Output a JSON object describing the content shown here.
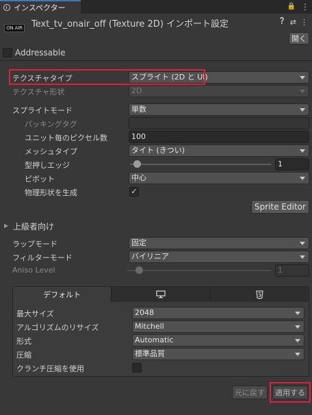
{
  "tab": {
    "label": "インスペクター"
  },
  "tab_icons": {
    "lock": "🔒",
    "menu": "⋮"
  },
  "header": {
    "badge": "ON AIR",
    "title": "Text_tv_onair_off (Texture 2D) インポート設定",
    "help": "❔",
    "settings": "⇄",
    "menu": "⋮",
    "open_label": "開く"
  },
  "addressable": {
    "label": "Addressable",
    "checked": false
  },
  "texture_type": {
    "label": "テクスチャタイプ",
    "value": "スプライト (2D と UI)"
  },
  "texture_shape": {
    "label": "テクスチャ形状",
    "value": "2D"
  },
  "sprite_mode": {
    "label": "スプライトモード",
    "value": "単数"
  },
  "packing_tag": {
    "label": "パッキングタグ",
    "value": ""
  },
  "pixels_per_unit": {
    "label": "ユニット毎のピクセル数",
    "value": "100"
  },
  "mesh_type": {
    "label": "メッシュタイプ",
    "value": "タイト (きつい)"
  },
  "extrude_edges": {
    "label": "型押しエッジ",
    "value": "1"
  },
  "pivot": {
    "label": "ピボット",
    "value": "中心"
  },
  "physics_shape": {
    "label": "物理形状を生成",
    "checked": true,
    "mark": "✓"
  },
  "sprite_editor": {
    "label": "Sprite Editor"
  },
  "advanced": {
    "label": "上級者向け",
    "arrow": "▶"
  },
  "wrap_mode": {
    "label": "ラップモード",
    "value": "固定"
  },
  "filter_mode": {
    "label": "フィルターモード",
    "value": "バイリニア"
  },
  "aniso": {
    "label": "Aniso Level",
    "value": "1"
  },
  "platform": {
    "tabs": [
      {
        "label": "デフォルト",
        "icon": ""
      },
      {
        "label": "",
        "icon": "monitor-icon"
      },
      {
        "label": "",
        "icon": "html5-icon"
      }
    ],
    "max_size": {
      "label": "最大サイズ",
      "value": "2048"
    },
    "resize": {
      "label": "アルゴリズムのリサイズ",
      "value": "Mitchell"
    },
    "format": {
      "label": "形式",
      "value": "Automatic"
    },
    "compression": {
      "label": "圧縮",
      "value": "標準品質"
    },
    "crunch": {
      "label": "クランチ圧縮を使用",
      "checked": false
    }
  },
  "footer": {
    "revert": "元に戻す",
    "apply": "適用する"
  },
  "colors": {
    "highlight": "#e0203a",
    "tab_accent": "#3a79bb"
  }
}
